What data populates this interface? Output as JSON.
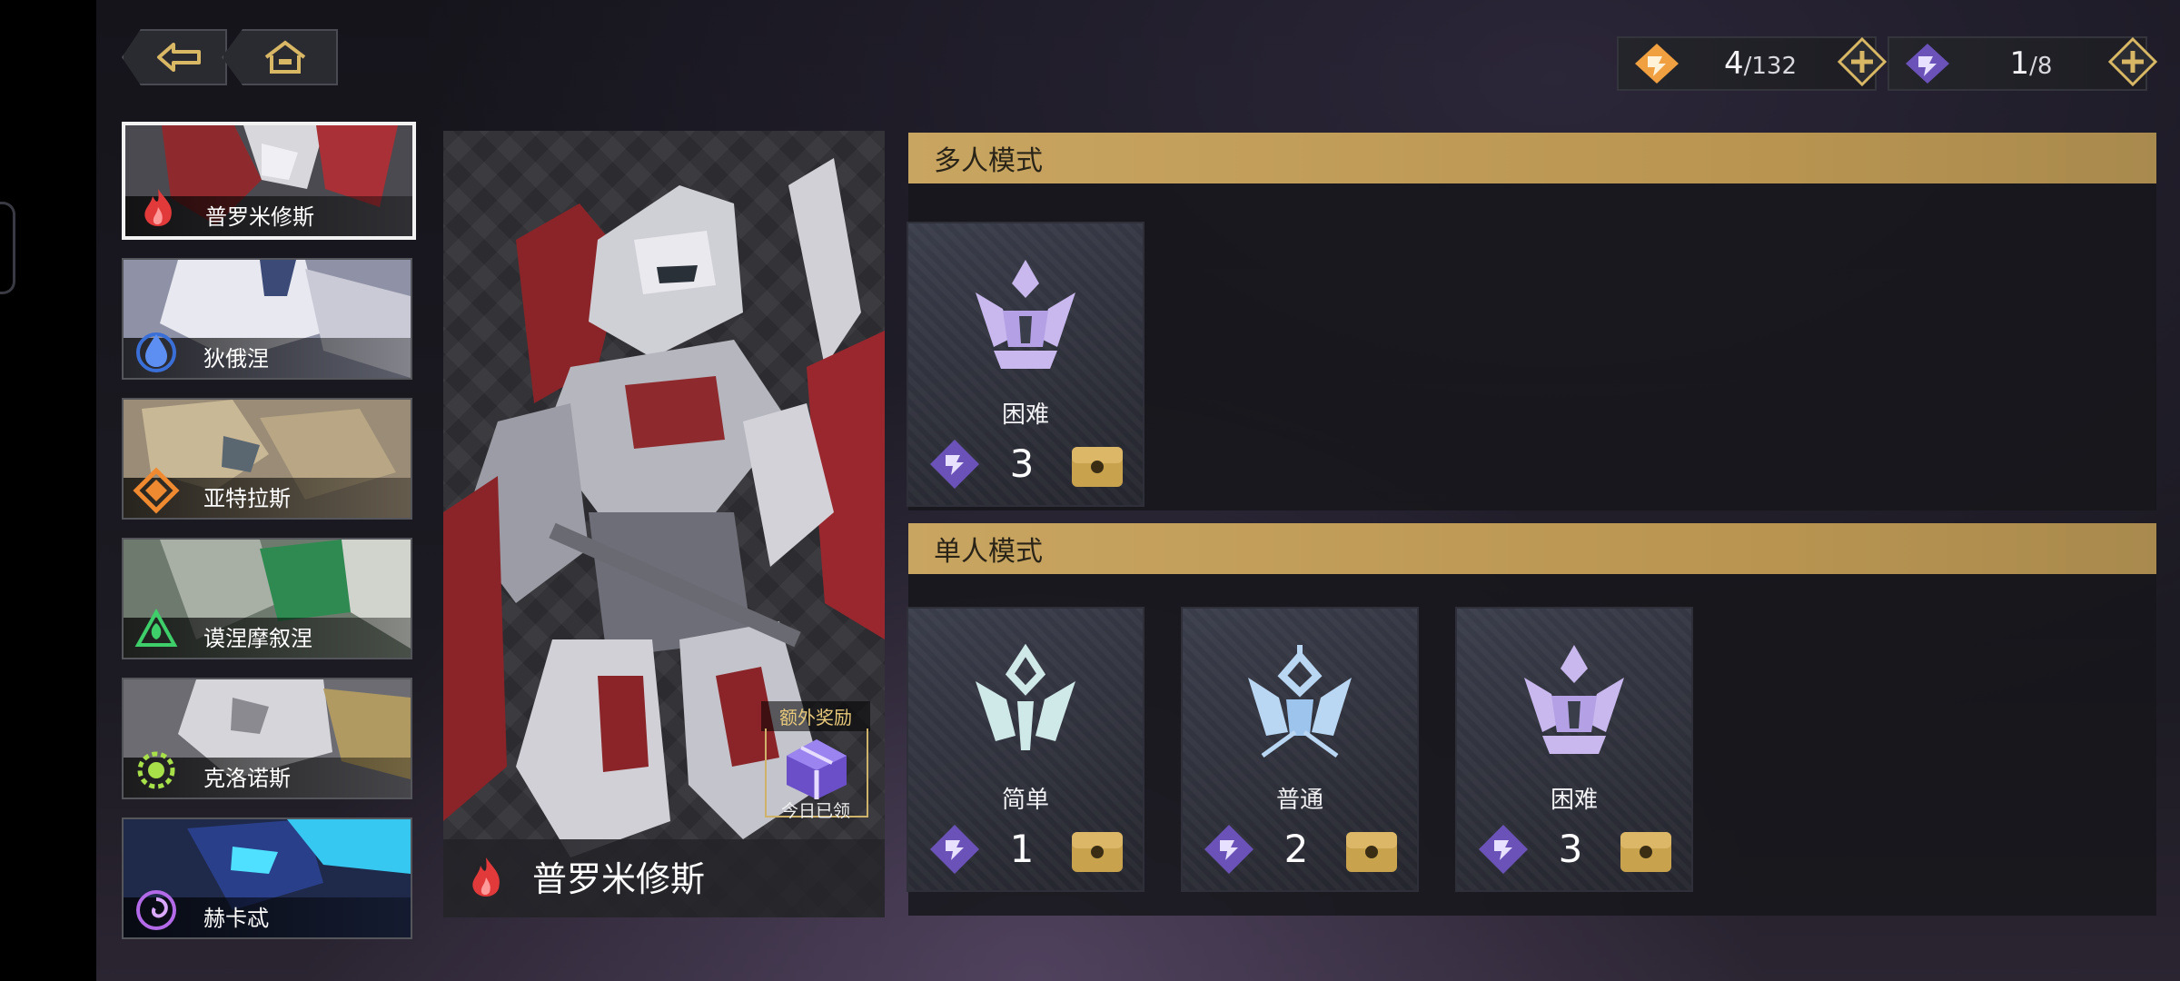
{
  "currencies": [
    {
      "current": "4",
      "max": "/132",
      "icon": "orange-diamond-emblem-icon",
      "color": "#f0a040"
    },
    {
      "current": "1",
      "max": "/8",
      "icon": "purple-diamond-emblem-icon",
      "color": "#8a6ad8"
    }
  ],
  "characters": [
    {
      "name": "普罗米修斯",
      "emblem": "flame-emblem-icon",
      "selected": true
    },
    {
      "name": "狄俄涅",
      "emblem": "water-drop-emblem-icon",
      "selected": false
    },
    {
      "name": "亚特拉斯",
      "emblem": "earth-emblem-icon",
      "selected": false
    },
    {
      "name": "谟涅摩叙涅",
      "emblem": "wind-emblem-icon",
      "selected": false
    },
    {
      "name": "克洛诺斯",
      "emblem": "sun-gear-emblem-icon",
      "selected": false
    },
    {
      "name": "赫卡忒",
      "emblem": "spiral-emblem-icon",
      "selected": false
    }
  ],
  "portrait": {
    "name": "普罗米修斯",
    "extra_reward": {
      "title": "额外奖励",
      "status": "今日已领"
    }
  },
  "multiplayer": {
    "title": "多人模式",
    "cards": [
      {
        "label": "困难",
        "count": "3"
      }
    ]
  },
  "singleplayer": {
    "title": "单人模式",
    "cards": [
      {
        "label": "简单",
        "count": "1"
      },
      {
        "label": "普通",
        "count": "2"
      },
      {
        "label": "困难",
        "count": "3"
      }
    ]
  },
  "colors": {
    "gold_header": "#c8a560",
    "crest_hard": "#c9b8ee",
    "crest_easy": "#cfe8e8",
    "crest_normal": "#b9d6f2"
  }
}
